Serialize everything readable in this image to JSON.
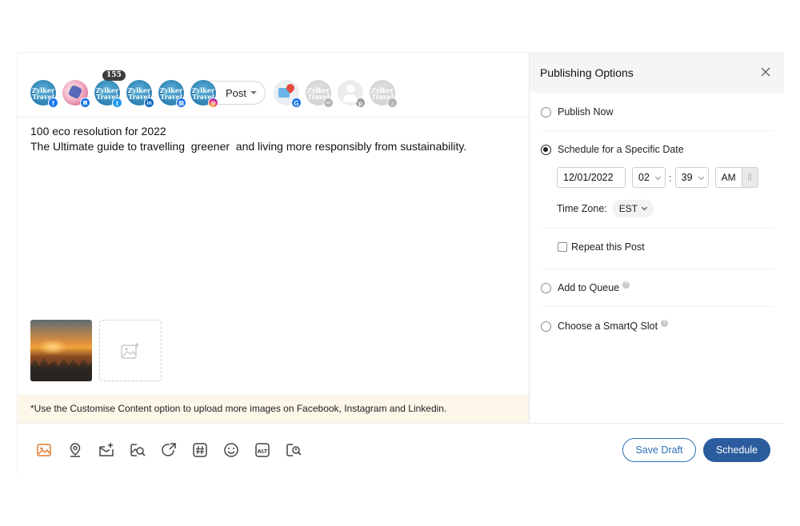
{
  "profiles": {
    "items": [
      {
        "name": "zylker-facebook",
        "text_top": "Zylker",
        "text_bottom": "Travel",
        "network": "facebook",
        "network_glyph": "f",
        "style": "zylker"
      },
      {
        "name": "profile-colorful",
        "network": "other",
        "network_glyph": "",
        "style": "colorful"
      },
      {
        "name": "zylker-twitter",
        "text_top": "Zylker",
        "text_bottom": "Travel",
        "network": "twitter",
        "network_glyph": "t",
        "style": "zylker",
        "count": "155"
      },
      {
        "name": "zylker-linkedin",
        "text_top": "Zylker",
        "text_bottom": "Travel",
        "network": "linkedin",
        "network_glyph": "in",
        "style": "zylker"
      },
      {
        "name": "zylker-gbp",
        "text_top": "Zylker",
        "text_bottom": "Travel",
        "network": "google-business",
        "network_glyph": "▤",
        "style": "zylker"
      },
      {
        "name": "zylker-instagram",
        "text_top": "Zylker",
        "text_bottom": "Travel",
        "network": "instagram",
        "network_glyph": "◎",
        "style": "zylker"
      }
    ],
    "post_type": "Post",
    "disabled": [
      {
        "name": "google-maps",
        "network_glyph": "G",
        "style": "gmaps"
      },
      {
        "name": "zylker-faded-1",
        "text_top": "Zylker",
        "text_bottom": "Travel",
        "network_glyph": "▭",
        "style": "faded-zy"
      },
      {
        "name": "person-pinterest",
        "network_glyph": "p",
        "style": "person"
      },
      {
        "name": "zylker-faded-2",
        "text_top": "Zylker",
        "text_bottom": "Travel",
        "network_glyph": "♪",
        "style": "faded-zy"
      }
    ]
  },
  "post": {
    "line1": "100 eco resolution for 2022",
    "line2": "The Ultimate guide to travelling  greener  and living more responsibly from sustainability."
  },
  "notice": "*Use the Customise Content option to upload more images on Facebook, Instagram and Linkedin.",
  "panel": {
    "title": "Publishing Options",
    "options": {
      "publish_now": "Publish Now",
      "schedule_specific": "Schedule for a Specific Date",
      "add_to_queue": "Add to Queue",
      "smartq": "Choose a SmartQ Slot"
    },
    "selected": "schedule_specific",
    "date": "12/01/2022",
    "hour": "02",
    "minute": "39",
    "ampm": "AM",
    "time_separator": ":",
    "pm_toggle_glyph": "||",
    "timezone_label": "Time Zone:",
    "timezone": "EST",
    "repeat_label": "Repeat this Post",
    "help_glyph": "?"
  },
  "footer": {
    "save_draft": "Save Draft",
    "schedule": "Schedule",
    "tools": [
      "image-icon",
      "location-icon",
      "mail-upload-icon",
      "search-image-icon",
      "share-icon",
      "hashtag-icon",
      "emoji-icon",
      "alt-text-icon",
      "search-user-icon"
    ],
    "alt_text_glyph": "ALT",
    "hashtag_glyph": "#"
  },
  "colors": {
    "primary": "#2b5c9e",
    "notice_bg": "#fdf7ea",
    "tool_active": "#e27a2e"
  }
}
